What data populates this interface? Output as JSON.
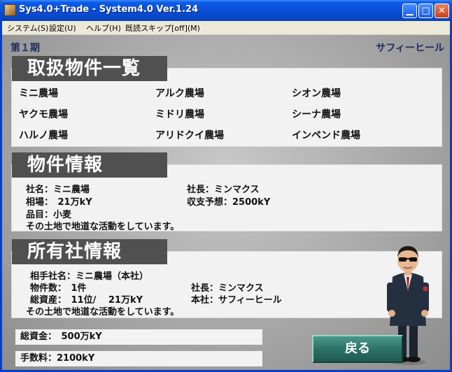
{
  "window": {
    "title": "Sys4.0+Trade - System4.0 Ver.1.24"
  },
  "menu": [
    "システム(S)",
    "設定(U)",
    "ヘルプ(H)",
    "既読スキップ[off](M)"
  ],
  "header": {
    "period": "第１期",
    "location": "サフィーヒール"
  },
  "properties": {
    "heading": "取扱物件一覧",
    "items": [
      "ミニ農場",
      "アルク農場",
      "シオン農場",
      "ヤクモ農場",
      "ミドリ農場",
      "シーナ農場",
      "ハルノ農場",
      "アリドクイ農場",
      "インペンド農場"
    ]
  },
  "property_info": {
    "heading": "物件情報",
    "company_name": "社名：ミニ農場",
    "president": "社長：ミンマクス",
    "market_price": "相場：　21万kY",
    "expected_profit": "収支予想：2500kY",
    "item": "品目：小麦",
    "description": "その土地で地道な活動をしています。"
  },
  "owner_info": {
    "heading": "所有社情報",
    "partner_name": "相手社名：ミニ農場（本社）",
    "property_count": "物件数：　1件",
    "president": "社長：ミンマクス",
    "total_assets": "総資産：　11位/　 21万kY",
    "head_office": "本社：サフィーヒール",
    "description": "その土地で地道な活動をしています。"
  },
  "funds": {
    "total_funds": "総資金：　500万kY",
    "fee": "手数料：2100kY"
  },
  "buttons": {
    "back": "戻る"
  },
  "colors": {
    "title_bar": "#0a4fd6",
    "header_tab": "#505050",
    "back_button": "#2c7266",
    "label_text": "#1e2a5e"
  }
}
